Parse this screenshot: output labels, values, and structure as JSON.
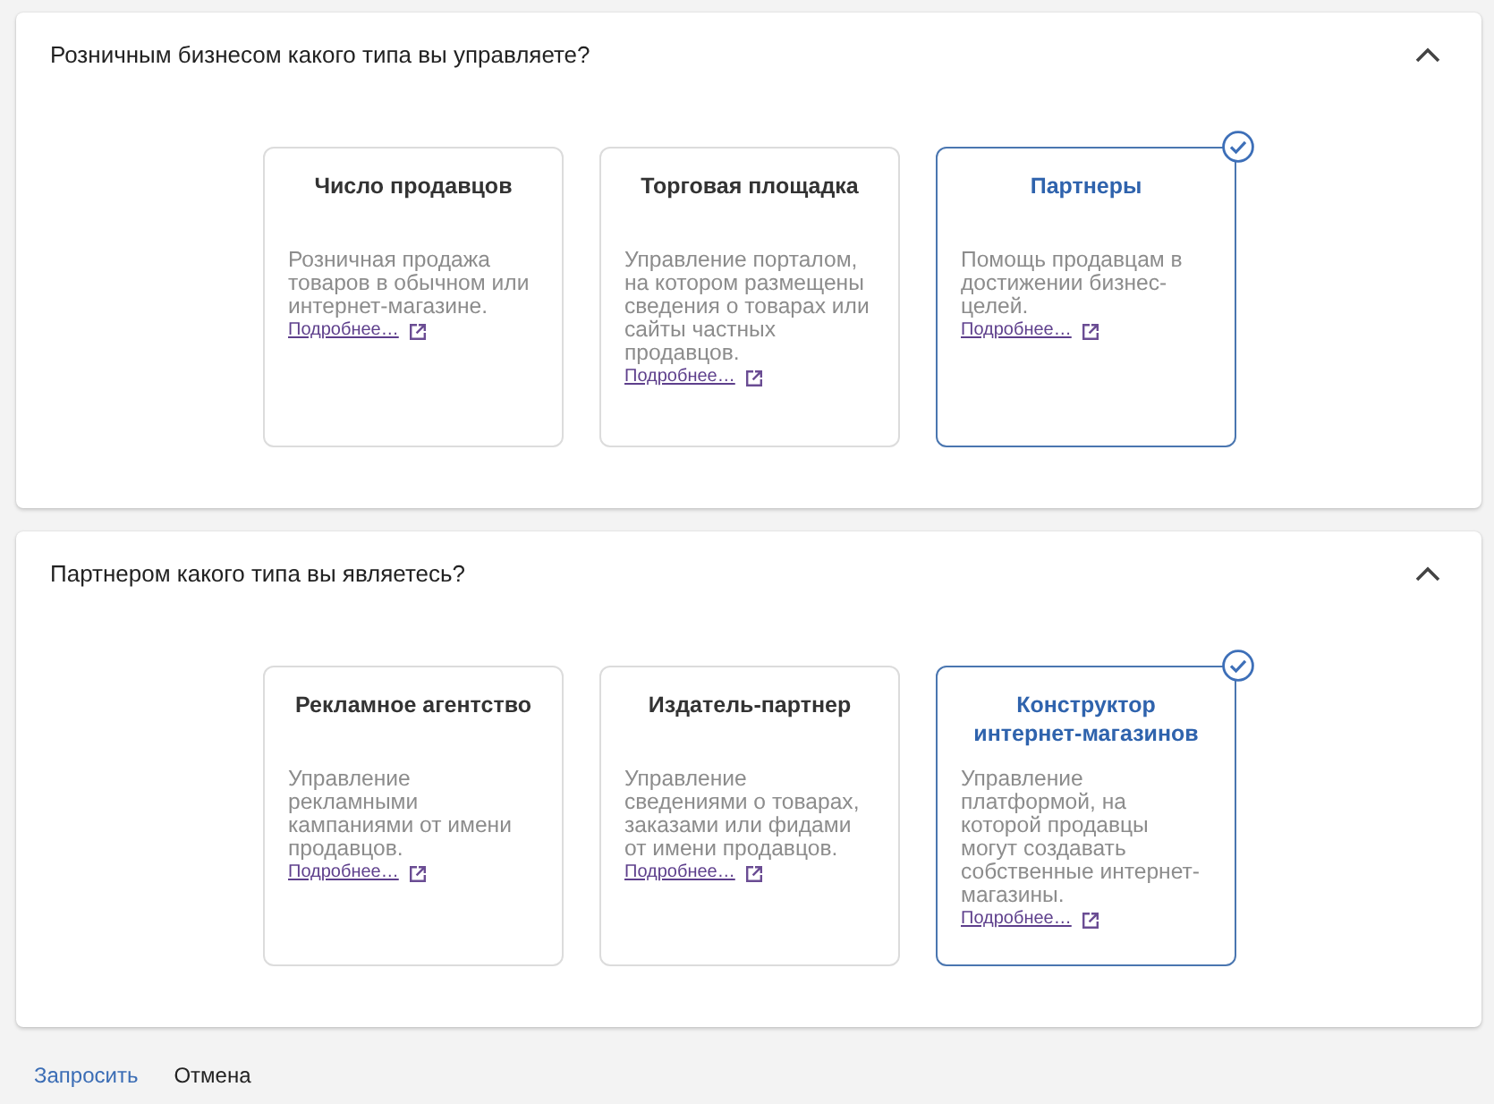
{
  "sections": [
    {
      "question": "Розничным бизнесом какого типа вы управляете?",
      "expanded": true,
      "options": [
        {
          "title": "Число продавцов",
          "description": "Розничная продажа товаров в обычном или интернет-магазине.",
          "link": "Подробнее…",
          "selected": false
        },
        {
          "title": "Торговая площадка",
          "description": "Управление порталом, на котором размещены сведения о товарах или сайты частных продавцов.",
          "link": "Подробнее…",
          "selected": false
        },
        {
          "title": "Партнеры",
          "description": "Помощь продавцам в достижении бизнес-целей.",
          "link": "Подробнее…",
          "selected": true
        }
      ]
    },
    {
      "question": "Партнером какого типа вы являетесь?",
      "expanded": true,
      "options": [
        {
          "title": "Рекламное агентство",
          "description": "Управление рекламными кампаниями от имени продавцов.",
          "link": "Подробнее…",
          "selected": false
        },
        {
          "title": "Издатель-партнер",
          "description": "Управление сведениями о товарах, заказами или фидами от имени продавцов.",
          "link": "Подробнее…",
          "selected": false
        },
        {
          "title": "Конструктор интернет-магазинов",
          "description": "Управление платформой, на которой продавцы могут создавать собственные интернет-магазины.",
          "link": "Подробнее…",
          "selected": true
        }
      ]
    }
  ],
  "actions": [
    {
      "label": "Запросить",
      "kind": "primary"
    },
    {
      "label": "Отмена",
      "kind": "secondary"
    }
  ]
}
